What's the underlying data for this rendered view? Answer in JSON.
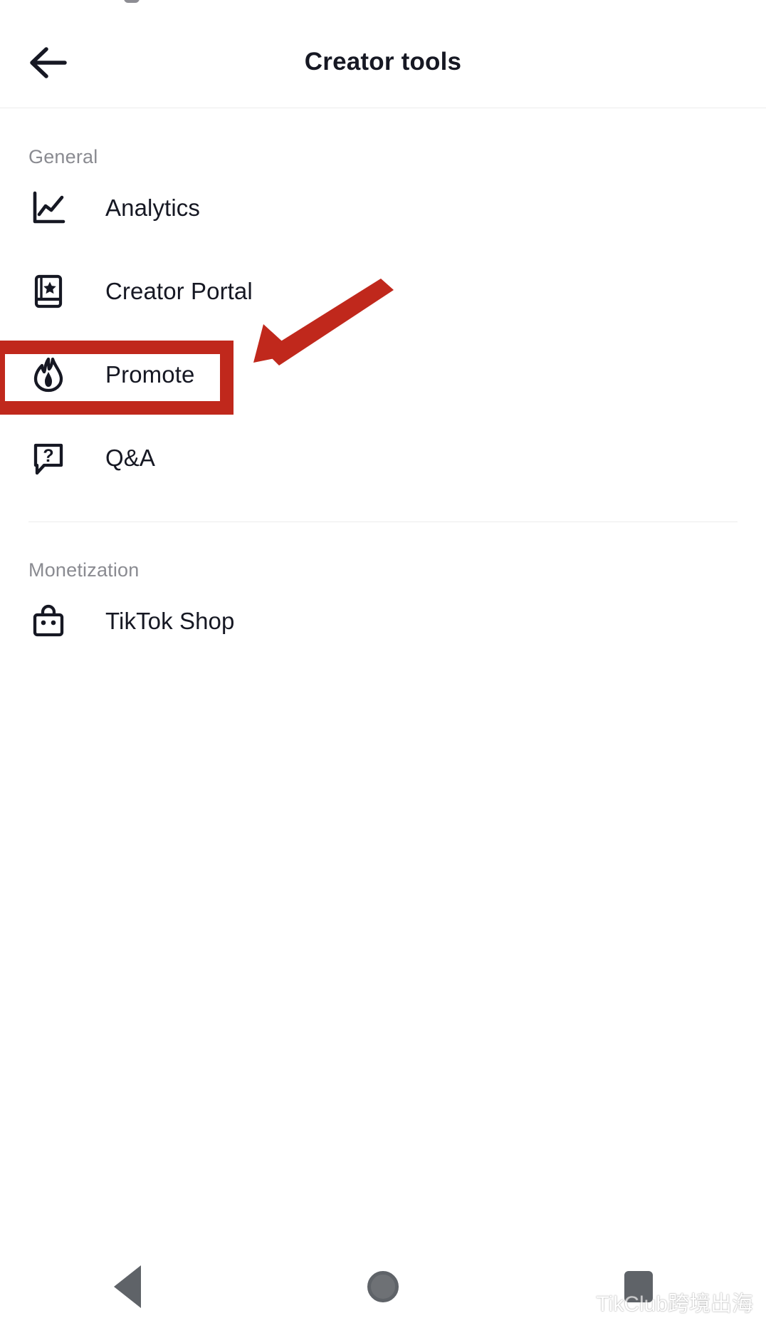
{
  "app": {
    "header": {
      "title": "Creator tools",
      "back_icon": "arrow-left-icon"
    }
  },
  "sections": [
    {
      "title": "General",
      "items": [
        {
          "label": "Analytics",
          "icon": "line-chart-icon"
        },
        {
          "label": "Creator Portal",
          "icon": "book-star-icon"
        },
        {
          "label": "Promote",
          "icon": "flame-icon",
          "highlighted": true
        },
        {
          "label": "Q&A",
          "icon": "speech-bubble-question-icon"
        }
      ]
    },
    {
      "title": "Monetization",
      "items": [
        {
          "label": "TikTok Shop",
          "icon": "shopping-bag-icon"
        }
      ]
    }
  ],
  "annotation": {
    "color": "#C0281C",
    "highlight_target": "Promote",
    "arrow": "down-left-arrow"
  },
  "navbar": {
    "back": "triangle-back-icon",
    "home": "circle-home-icon",
    "recents": "square-recents-icon"
  },
  "watermark": {
    "text": "TikClub跨境出海",
    "icon": "wechat-icon"
  }
}
